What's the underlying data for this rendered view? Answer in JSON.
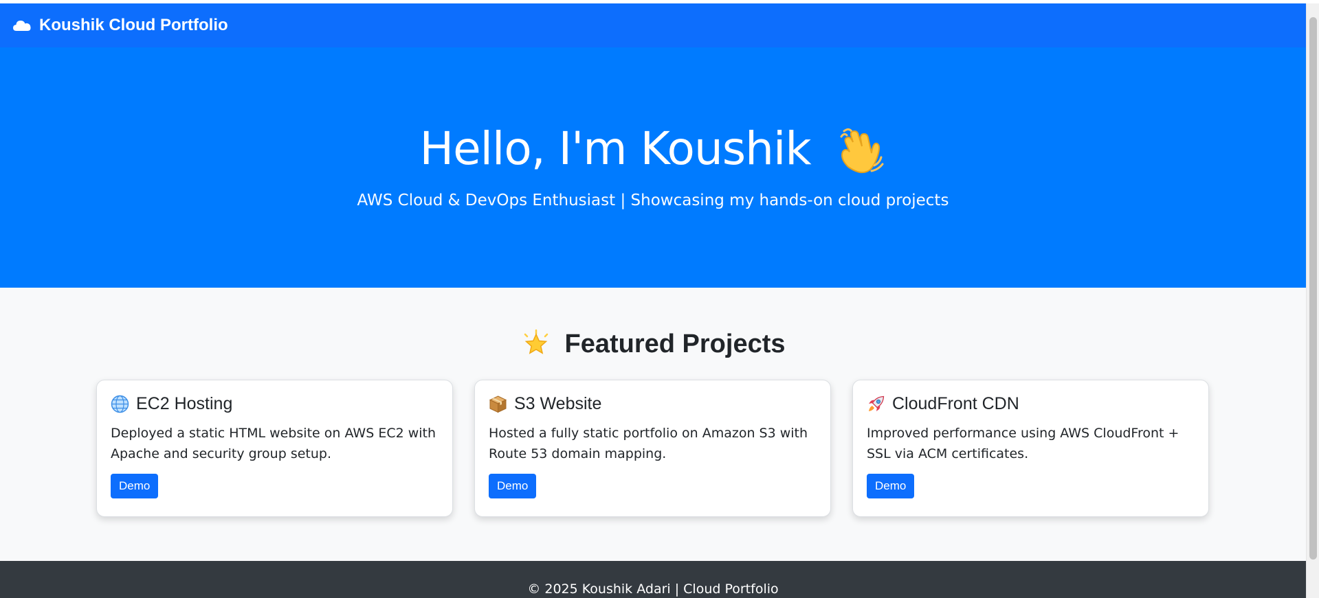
{
  "navbar": {
    "brand_label": "Koushik Cloud Portfolio",
    "brand_icon": "cloud-icon"
  },
  "hero": {
    "heading": "Hello, I'm Koushik",
    "heading_icon": "waving-hand-icon",
    "subtitle": "AWS Cloud & DevOps Enthusiast | Showcasing my hands-on cloud projects"
  },
  "projects": {
    "heading": "Featured Projects",
    "heading_icon": "star-icon",
    "cards": [
      {
        "title": "EC2 Hosting",
        "icon": "globe-icon",
        "description": "Deployed a static HTML website on AWS EC2 with Apache and security group setup.",
        "button_label": "Demo"
      },
      {
        "title": "S3 Website",
        "icon": "package-icon",
        "description": "Hosted a fully static portfolio on Amazon S3 with Route 53 domain mapping.",
        "button_label": "Demo"
      },
      {
        "title": "CloudFront CDN",
        "icon": "rocket-icon",
        "description": "Improved performance using AWS CloudFront + SSL via ACM certificates.",
        "button_label": "Demo"
      }
    ]
  },
  "footer": {
    "text": "© 2025 Koushik Adari | Cloud Portfolio"
  },
  "colors": {
    "navbar": "#0d6efd",
    "hero": "#007bff",
    "button": "#0d6efd",
    "footer": "#343a40",
    "page_bg": "#f8f9fa"
  }
}
